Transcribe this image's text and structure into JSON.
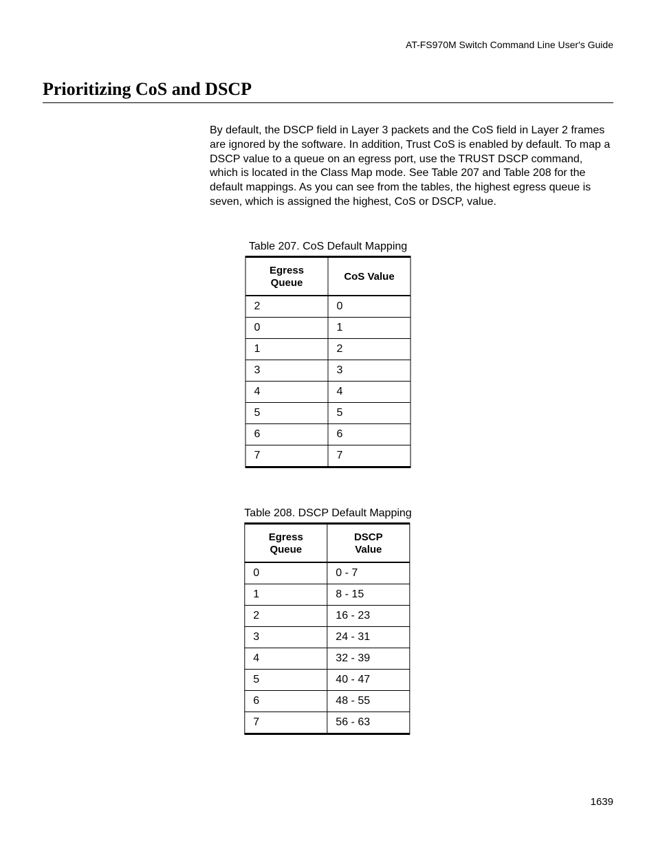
{
  "header": {
    "guide_title": "AT-FS970M Switch Command Line User's Guide"
  },
  "section": {
    "title": "Prioritizing CoS and DSCP"
  },
  "body": {
    "paragraph": "By default, the DSCP field in Layer 3 packets and the CoS field in Layer 2 frames are ignored by the software. In addition, Trust CoS is enabled by default. To map a DSCP value to a queue on an egress port, use the TRUST DSCP command, which is located in the Class Map mode. See Table 207 and Table 208 for the default mappings. As you can see from the tables, the highest egress queue is seven, which is assigned the highest, CoS or DSCP, value."
  },
  "table207": {
    "caption": "Table 207. CoS Default Mapping",
    "headers": {
      "col1": "Egress Queue",
      "col2": "CoS Value"
    },
    "rows": [
      {
        "egress": "2",
        "value": "0"
      },
      {
        "egress": "0",
        "value": "1"
      },
      {
        "egress": "1",
        "value": "2"
      },
      {
        "egress": "3",
        "value": "3"
      },
      {
        "egress": "4",
        "value": "4"
      },
      {
        "egress": "5",
        "value": "5"
      },
      {
        "egress": "6",
        "value": "6"
      },
      {
        "egress": "7",
        "value": "7"
      }
    ]
  },
  "table208": {
    "caption": "Table 208. DSCP Default Mapping",
    "headers": {
      "col1": "Egress Queue",
      "col2": "DSCP Value"
    },
    "rows": [
      {
        "egress": "0",
        "value": "0 - 7"
      },
      {
        "egress": "1",
        "value": "8 - 15"
      },
      {
        "egress": "2",
        "value": "16 - 23"
      },
      {
        "egress": "3",
        "value": "24 - 31"
      },
      {
        "egress": "4",
        "value": "32 - 39"
      },
      {
        "egress": "5",
        "value": "40 - 47"
      },
      {
        "egress": "6",
        "value": "48 - 55"
      },
      {
        "egress": "7",
        "value": "56 - 63"
      }
    ]
  },
  "footer": {
    "page_number": "1639"
  }
}
